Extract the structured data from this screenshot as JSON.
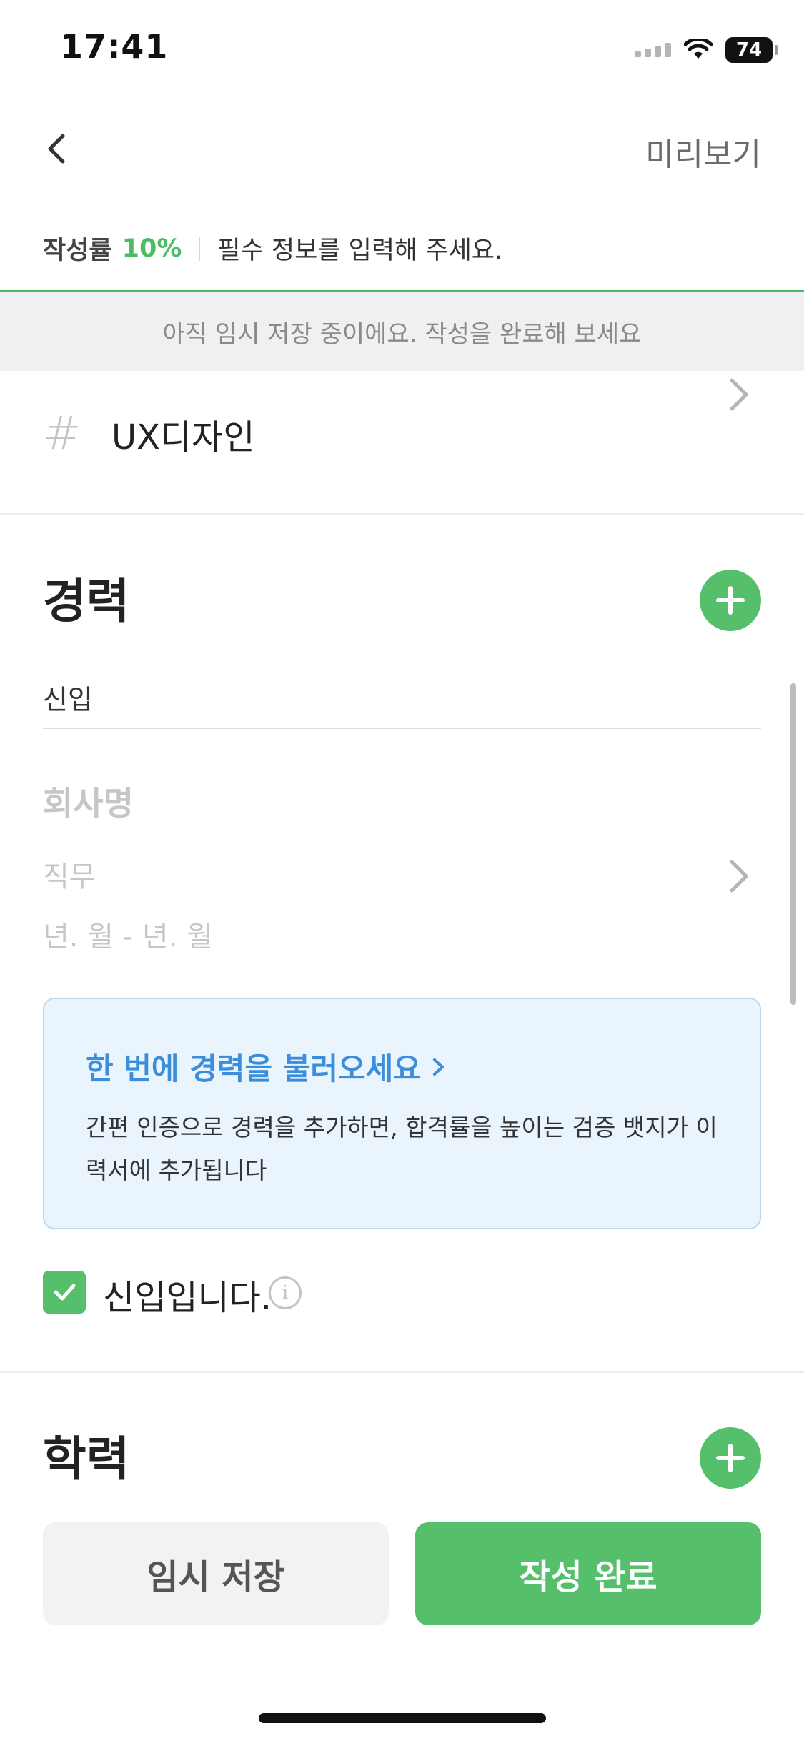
{
  "status_bar": {
    "time": "17:41",
    "battery": "74"
  },
  "nav": {
    "preview_label": "미리보기"
  },
  "progress": {
    "label": "작성률",
    "percent_text": "10%",
    "percent_value": 0.1,
    "message": "필수 정보를 입력해 주세요."
  },
  "save_banner": {
    "text": "아직 임시 저장 중이에요. 작성을 완료해 보세요"
  },
  "skill": {
    "hash": "#",
    "value": "UX디자인"
  },
  "career": {
    "title": "경력",
    "type_value": "신입",
    "company_placeholder": "회사명",
    "role_placeholder": "직무",
    "period_placeholder": "년. 월 - 년. 월",
    "import_card": {
      "title": "한 번에 경력을 불러오세요",
      "body": "간편 인증으로 경력을 추가하면, 합격률을 높이는 검증 뱃지가 이력서에 추가됩니다"
    },
    "newcomer_checkbox": {
      "label": "신입입니다.",
      "checked": true
    }
  },
  "education": {
    "title": "학력"
  },
  "footer": {
    "temp_save_label": "임시 저장",
    "complete_label": "작성 완료"
  },
  "colors": {
    "accent": "#55bf6c",
    "info_blue": "#3b8ed9",
    "info_bg": "#eaf4fd"
  },
  "icons": [
    "back-chevron-icon",
    "chevron-right-icon",
    "plus-icon",
    "check-icon",
    "info-icon",
    "wifi-icon",
    "signal-icon",
    "battery-icon"
  ]
}
